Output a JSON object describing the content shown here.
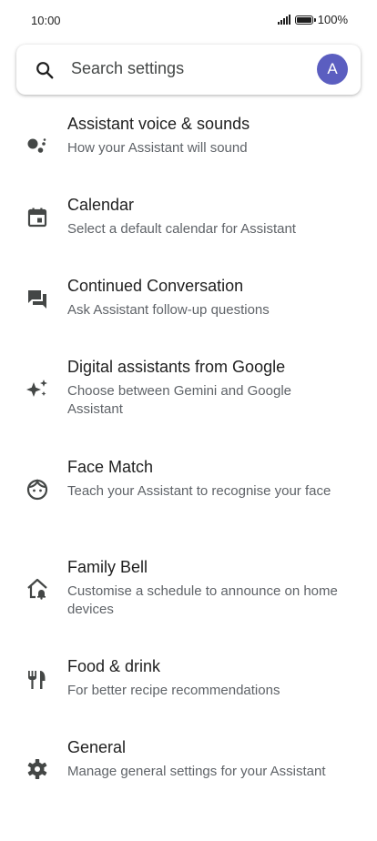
{
  "status_bar": {
    "time": "10:00",
    "battery": "100%"
  },
  "search": {
    "placeholder": "Search settings",
    "avatar_letter": "A",
    "avatar_color": "#5b5ec0"
  },
  "settings": [
    {
      "title": "Assistant voice & sounds",
      "description": "How your Assistant will sound",
      "icon": "assistant-voice-icon"
    },
    {
      "title": "Calendar",
      "description": "Select a default calendar for Assistant",
      "icon": "calendar-icon"
    },
    {
      "title": "Continued Conversation",
      "description": "Ask Assistant follow-up questions",
      "icon": "chat-icon"
    },
    {
      "title": "Digital assistants from Google",
      "description": "Choose between Gemini and Google Assistant",
      "icon": "sparkle-icon"
    },
    {
      "title": "Face Match",
      "description": "Teach your Assistant to recognise your face",
      "icon": "face-icon"
    },
    {
      "title": "Family Bell",
      "description": "Customise a schedule to announce on home devices",
      "icon": "home-bell-icon"
    },
    {
      "title": "Food & drink",
      "description": "For better recipe recommendations",
      "icon": "restaurant-icon"
    },
    {
      "title": "General",
      "description": "Manage general settings for your Assistant",
      "icon": "gear-icon"
    }
  ]
}
